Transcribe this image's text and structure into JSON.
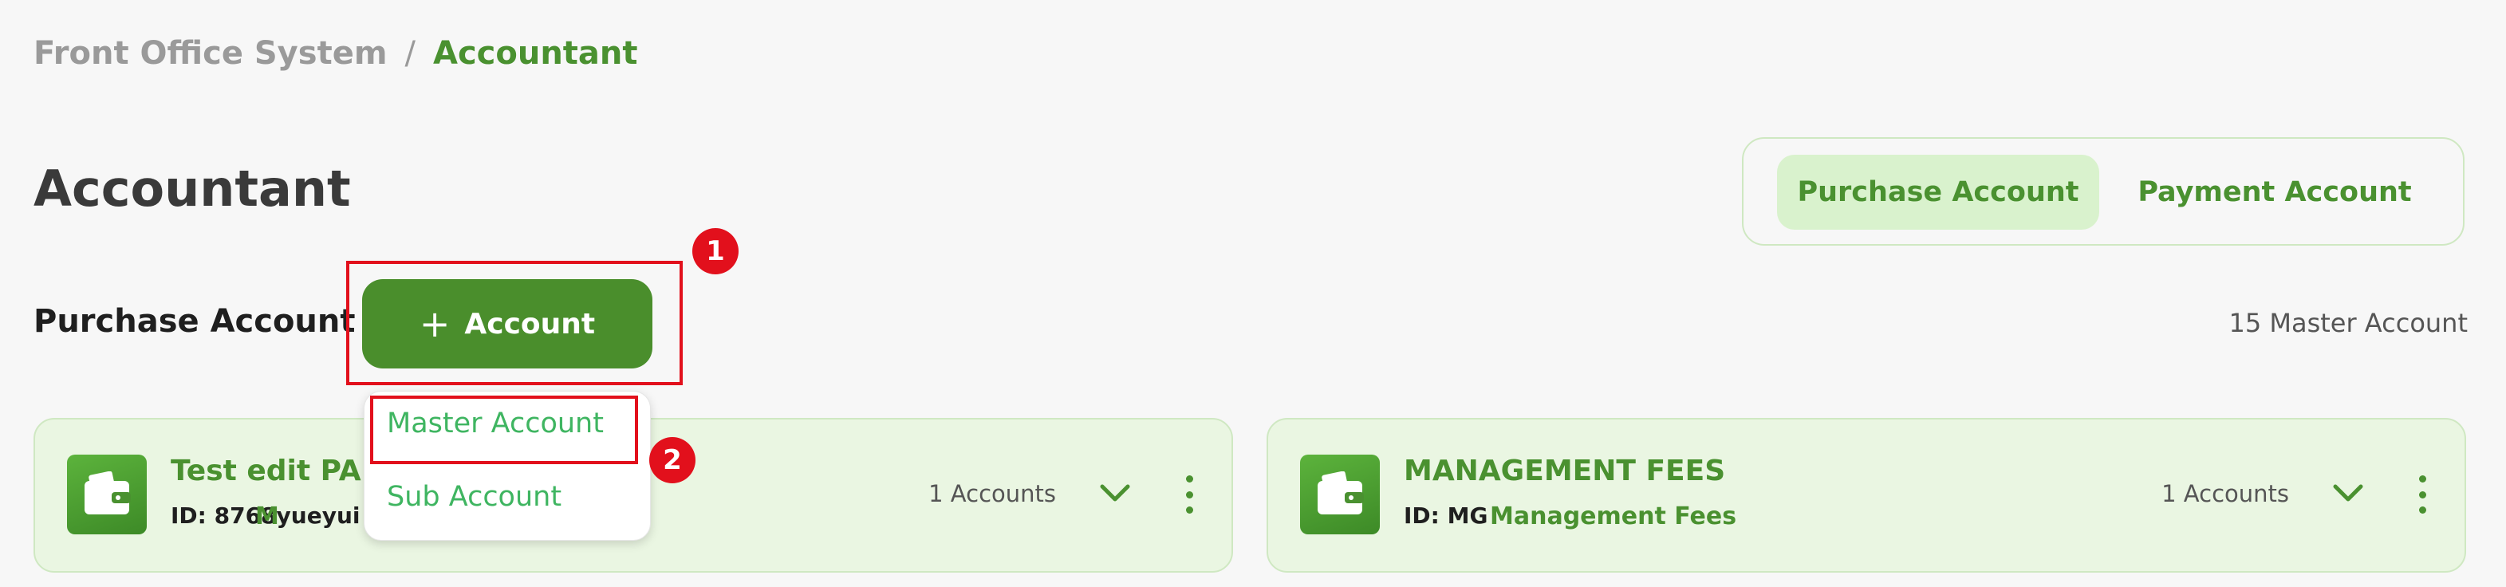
{
  "breadcrumb": {
    "root": "Front Office System",
    "separator": "/",
    "current": "Accountant"
  },
  "page": {
    "title": "Accountant"
  },
  "tabs": [
    {
      "label": "Purchase Account",
      "active": true
    },
    {
      "label": "Payment Account",
      "active": false
    }
  ],
  "section": {
    "label": "Purchase Account",
    "add_button_label": "Account",
    "master_count": "15 Master Account"
  },
  "annotations": {
    "step1": "1",
    "step2": "2"
  },
  "dropdown": {
    "items": [
      "Master Account",
      "Sub Account"
    ]
  },
  "cards": [
    {
      "title": "Test edit PA",
      "id": "ID: 8768yueyui",
      "category": "M",
      "accounts": "1 Accounts"
    },
    {
      "title": "MANAGEMENT FEES",
      "id": "ID: MG",
      "category": "Management Fees",
      "accounts": "1 Accounts"
    }
  ],
  "colors": {
    "accent": "#4a9130",
    "button": "#4a8e2c",
    "highlight": "#e2101c",
    "card_bg": "#eaf6e2"
  },
  "icons": {
    "add": "plus-icon",
    "card": "wallet-icon",
    "expand": "chevron-down-icon",
    "menu": "more-vertical-icon"
  }
}
